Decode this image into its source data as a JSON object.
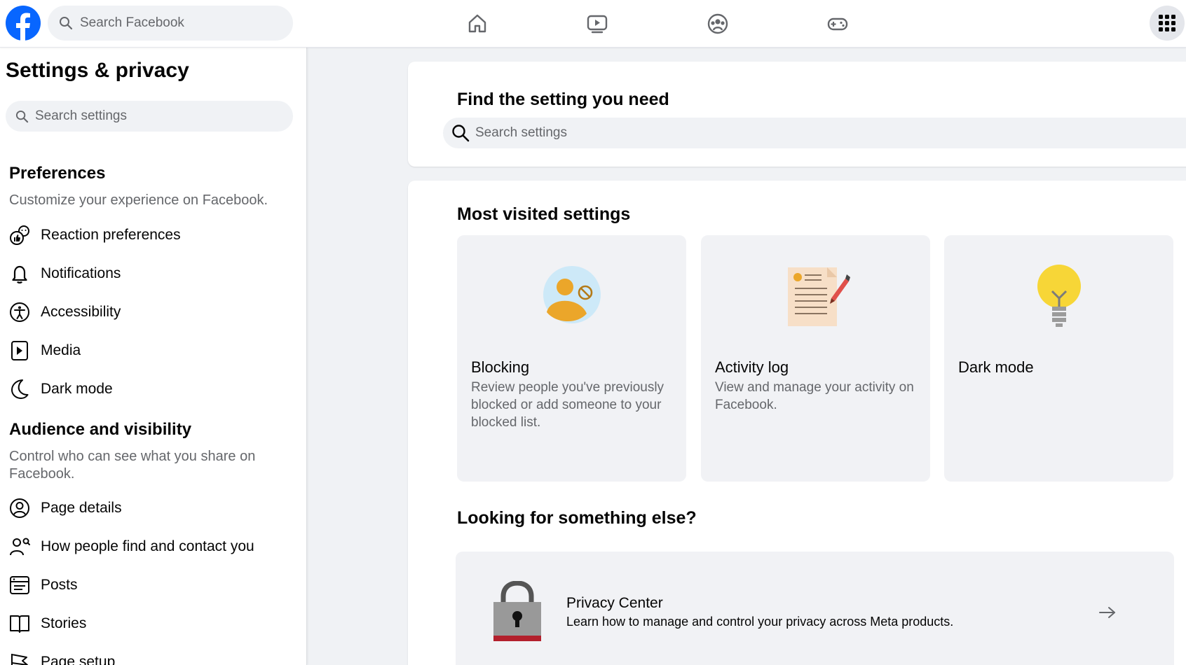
{
  "topbar": {
    "search_placeholder": "Search Facebook",
    "nav": [
      "home-icon",
      "video-icon",
      "groups-icon",
      "gaming-icon"
    ],
    "brand_color": "#0866ff"
  },
  "sidebar": {
    "title": "Settings & privacy",
    "search_placeholder": "Search settings",
    "preferences": {
      "title": "Preferences",
      "desc": "Customize your experience on Facebook.",
      "items": [
        "Reaction preferences",
        "Notifications",
        "Accessibility",
        "Media",
        "Dark mode"
      ]
    },
    "audience": {
      "title": "Audience and visibility",
      "desc": "Control who can see what you share on Facebook.",
      "items": [
        "Page details",
        "How people find and contact you",
        "Posts",
        "Stories",
        "Page setup"
      ]
    }
  },
  "main": {
    "find": {
      "title": "Find the setting you need",
      "search_placeholder": "Search settings"
    },
    "most_visited": {
      "title": "Most visited settings",
      "tiles": [
        {
          "title": "Blocking",
          "desc": "Review people you've previously blocked or add someone to your blocked list."
        },
        {
          "title": "Activity log",
          "desc": "View and manage your activity on Facebook."
        },
        {
          "title": "Dark mode",
          "desc": ""
        }
      ]
    },
    "else": {
      "title": "Looking for something else?",
      "privacy_title": "Privacy Center",
      "privacy_desc": "Learn how to manage and control your privacy across Meta products."
    }
  }
}
